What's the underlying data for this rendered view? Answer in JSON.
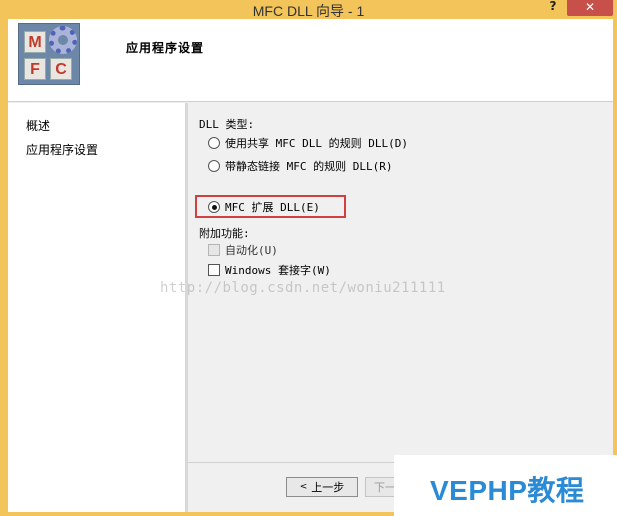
{
  "window": {
    "title": "MFC DLL 向导 - 1",
    "help_label": "?",
    "close_label": "✕"
  },
  "header": {
    "logo_letters": [
      "M",
      "F",
      "C"
    ],
    "title": "应用程序设置"
  },
  "nav": {
    "items": [
      {
        "label": "概述"
      },
      {
        "label": "应用程序设置"
      }
    ]
  },
  "content": {
    "dll_type_label": "DLL 类型:",
    "dll_types": [
      {
        "label": "使用共享 MFC DLL 的规则 DLL(D)",
        "selected": false
      },
      {
        "label": "带静态链接 MFC 的规则 DLL(R)",
        "selected": false
      },
      {
        "label": "MFC 扩展 DLL(E)",
        "selected": true
      }
    ],
    "extra_label": "附加功能:",
    "extras": [
      {
        "label": "自动化(U)",
        "checked": false,
        "enabled": false
      },
      {
        "label": "Windows 套接字(W)",
        "checked": false,
        "enabled": true
      }
    ]
  },
  "watermark": "http://blog.csdn.net/woniu211111",
  "footer": {
    "prev_label": "上一步",
    "next_label": "下一"
  },
  "brand": {
    "text": "VEPHP教程"
  },
  "colors": {
    "title_bar": "#f2c45a",
    "close_button": "#c7504b",
    "highlight": "#d04040",
    "brand": "#2a8ad6"
  }
}
